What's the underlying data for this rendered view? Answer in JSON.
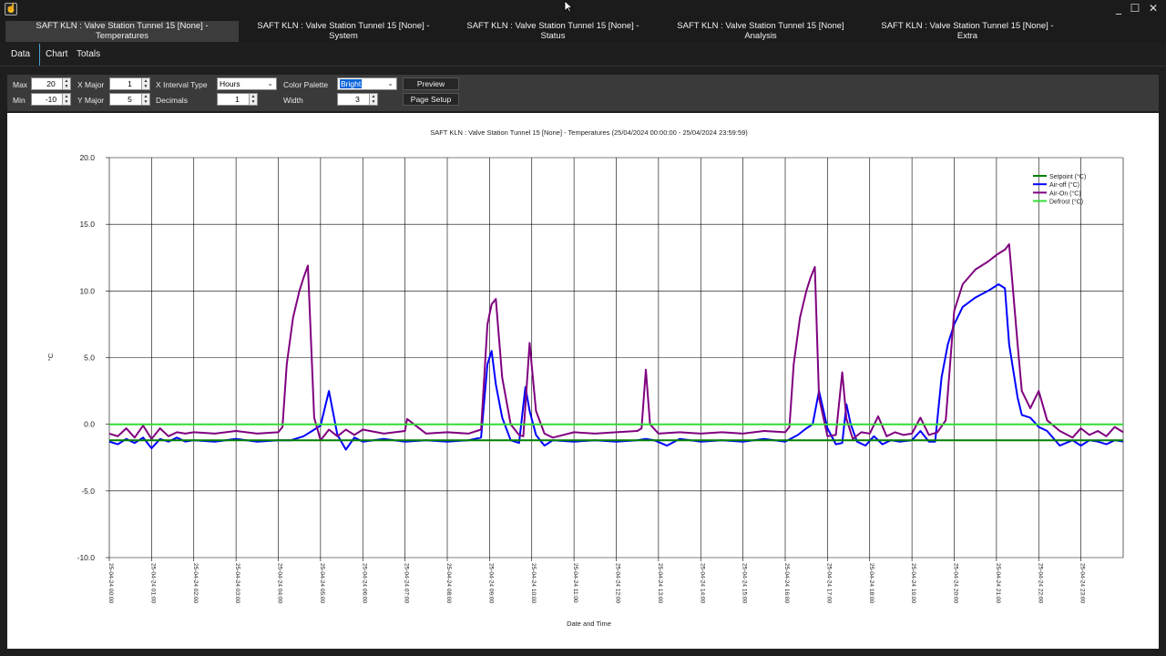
{
  "window": {
    "minimize_glyph": "_",
    "maximize_glyph": "☐",
    "close_glyph": "✕"
  },
  "tabs": [
    {
      "line1": "SAFT KLN : Valve Station Tunnel 15 [None] -",
      "line2": "Temperatures",
      "active": true
    },
    {
      "line1": "SAFT KLN : Valve Station Tunnel 15 [None] -",
      "line2": "System",
      "active": false
    },
    {
      "line1": "SAFT KLN : Valve Station Tunnel 15 [None] -",
      "line2": "Status",
      "active": false
    },
    {
      "line1": "SAFT KLN : Valve Station Tunnel 15 [None]",
      "line2": "Analysis",
      "active": false
    },
    {
      "line1": "SAFT KLN : Valve Station Tunnel 15 [None] -",
      "line2": "Extra",
      "active": false
    }
  ],
  "subtabs": [
    "Data",
    "Chart",
    "Totals"
  ],
  "toolbar": {
    "max_label": "Max",
    "max_value": "20",
    "min_label": "Min",
    "min_value": "-10",
    "x_major_label": "X Major",
    "x_major_value": "1",
    "y_major_label": "Y Major",
    "y_major_value": "5",
    "x_interval_label": "X Interval Type",
    "x_interval_value": "Hours",
    "decimals_label": "Decimals",
    "decimals_value": "1",
    "palette_label": "Color Palette",
    "palette_value": "Bright",
    "width_label": "Width",
    "width_value": "3",
    "preview_label": "Preview",
    "page_setup_label": "Page Setup"
  },
  "chart_data": {
    "type": "line",
    "title": "SAFT KLN : Valve Station Tunnel 15 [None] - Temperatures (25/04/2024 00:00:00 - 25/04/2024 23:59:59)",
    "xlabel": "Date and Time",
    "ylabel": "°C",
    "ylim": [
      -10,
      20
    ],
    "yticks": [
      "20.0",
      "15.0",
      "10.0",
      "5.0",
      "0.0",
      "-5.0",
      "-10.0"
    ],
    "xlim": [
      0,
      24
    ],
    "xticks": [
      "25-04-24 00:00",
      "25-04-24 01:00",
      "25-04-24 02:00",
      "25-04-24 03:00",
      "25-04-24 04:00",
      "25-04-24 05:00",
      "25-04-24 06:00",
      "25-04-24 07:00",
      "25-04-24 08:00",
      "25-04-24 09:00",
      "25-04-24 10:00",
      "25-04-24 11:00",
      "25-04-24 12:00",
      "25-04-24 13:00",
      "25-04-24 14:00",
      "25-04-24 15:00",
      "25-04-24 16:00",
      "25-04-24 17:00",
      "25-04-24 18:00",
      "25-04-24 19:00",
      "25-04-24 20:00",
      "25-04-24 21:00",
      "25-04-24 22:00",
      "25-04-24 23:00"
    ],
    "grid": true,
    "legend_position": "top-right",
    "series": [
      {
        "name": "Setpoint (°C)",
        "color": "#008000",
        "x": [
          0,
          24
        ],
        "y": [
          -1.2,
          -1.2
        ]
      },
      {
        "name": "Air-off (°C)",
        "color": "#0000ff",
        "x": [
          0,
          0.2,
          0.4,
          0.6,
          0.8,
          1.0,
          1.2,
          1.4,
          1.6,
          1.8,
          2.0,
          2.5,
          3.0,
          3.5,
          4.0,
          4.3,
          4.6,
          4.8,
          5.0,
          5.2,
          5.4,
          5.6,
          5.8,
          6.0,
          6.5,
          7.0,
          7.5,
          8.0,
          8.5,
          8.8,
          8.95,
          9.05,
          9.15,
          9.3,
          9.5,
          9.7,
          9.85,
          9.95,
          10.1,
          10.3,
          10.5,
          11.0,
          11.5,
          12.0,
          12.5,
          12.7,
          12.9,
          13.2,
          13.5,
          14.0,
          14.5,
          15.0,
          15.5,
          16.0,
          16.3,
          16.5,
          16.65,
          16.8,
          17.0,
          17.2,
          17.35,
          17.45,
          17.55,
          17.7,
          17.9,
          18.1,
          18.3,
          18.5,
          18.7,
          19.0,
          19.2,
          19.4,
          19.55,
          19.7,
          19.85,
          20.0,
          20.2,
          20.5,
          20.8,
          21.05,
          21.2,
          21.3,
          21.5,
          21.6,
          21.8,
          22.0,
          22.2,
          22.5,
          22.8,
          23.0,
          23.2,
          23.4,
          23.6,
          23.8,
          24.0
        ],
        "y": [
          -1.3,
          -1.5,
          -1.1,
          -1.4,
          -1.0,
          -1.8,
          -1.1,
          -1.3,
          -1.0,
          -1.3,
          -1.2,
          -1.3,
          -1.1,
          -1.3,
          -1.2,
          -1.2,
          -0.9,
          -0.5,
          -0.1,
          2.5,
          -0.8,
          -1.9,
          -1.0,
          -1.3,
          -1.1,
          -1.3,
          -1.2,
          -1.3,
          -1.2,
          -1.0,
          4.5,
          5.5,
          3.0,
          0.5,
          -1.2,
          -1.4,
          2.8,
          1.0,
          -0.8,
          -1.6,
          -1.2,
          -1.3,
          -1.2,
          -1.3,
          -1.2,
          -1.1,
          -1.2,
          -1.6,
          -1.1,
          -1.3,
          -1.2,
          -1.3,
          -1.1,
          -1.3,
          -0.8,
          -0.3,
          0.0,
          2.5,
          -0.3,
          -1.5,
          -1.4,
          1.5,
          0.0,
          -1.3,
          -1.6,
          -0.9,
          -1.5,
          -1.2,
          -1.3,
          -1.2,
          -0.5,
          -1.3,
          -1.3,
          3.5,
          6.0,
          7.5,
          8.8,
          9.5,
          10.0,
          10.5,
          10.2,
          6.0,
          2.0,
          0.7,
          0.5,
          -0.2,
          -0.5,
          -1.6,
          -1.2,
          -1.6,
          -1.2,
          -1.3,
          -1.5,
          -1.2,
          -1.3
        ]
      },
      {
        "name": "Air-On (°C)",
        "color": "#800080",
        "x": [
          0,
          0.2,
          0.4,
          0.6,
          0.8,
          1.0,
          1.2,
          1.4,
          1.6,
          1.8,
          2.0,
          2.5,
          3.0,
          3.5,
          4.0,
          4.1,
          4.2,
          4.35,
          4.5,
          4.6,
          4.7,
          4.85,
          5.0,
          5.2,
          5.4,
          5.6,
          5.8,
          6.0,
          6.5,
          7.0,
          7.05,
          7.5,
          8.0,
          8.5,
          8.8,
          8.95,
          9.05,
          9.15,
          9.3,
          9.5,
          9.7,
          9.8,
          9.95,
          10.1,
          10.3,
          10.5,
          11.0,
          11.5,
          12.0,
          12.5,
          12.6,
          12.7,
          12.8,
          13.0,
          13.5,
          14.0,
          14.5,
          15.0,
          15.5,
          16.0,
          16.1,
          16.2,
          16.35,
          16.5,
          16.6,
          16.7,
          16.8,
          17.0,
          17.2,
          17.35,
          17.45,
          17.6,
          17.8,
          18.0,
          18.2,
          18.4,
          18.6,
          18.8,
          19.0,
          19.2,
          19.4,
          19.6,
          19.8,
          20.0,
          20.2,
          20.5,
          20.8,
          21.0,
          21.1,
          21.2,
          21.3,
          21.5,
          21.6,
          21.8,
          22.0,
          22.2,
          22.5,
          22.8,
          23.0,
          23.2,
          23.4,
          23.6,
          23.8,
          24.0
        ],
        "y": [
          -0.7,
          -0.9,
          -0.3,
          -1.0,
          -0.1,
          -1.1,
          -0.3,
          -0.9,
          -0.6,
          -0.7,
          -0.6,
          -0.7,
          -0.5,
          -0.7,
          -0.6,
          -0.2,
          4.5,
          8.0,
          10.0,
          11.0,
          11.9,
          0.5,
          -1.2,
          -0.4,
          -0.9,
          -0.4,
          -0.8,
          -0.4,
          -0.7,
          -0.5,
          0.4,
          -0.7,
          -0.6,
          -0.7,
          -0.4,
          7.5,
          9.0,
          9.4,
          3.5,
          0.0,
          -0.8,
          -0.9,
          6.1,
          1.0,
          -0.7,
          -1.0,
          -0.6,
          -0.7,
          -0.6,
          -0.5,
          -0.3,
          4.1,
          0.0,
          -0.7,
          -0.6,
          -0.7,
          -0.6,
          -0.7,
          -0.5,
          -0.6,
          -0.2,
          4.5,
          8.0,
          10.0,
          11.0,
          11.8,
          2.0,
          -0.9,
          -0.8,
          3.9,
          0.4,
          -1.1,
          -0.6,
          -0.7,
          0.6,
          -0.9,
          -0.6,
          -0.8,
          -0.7,
          0.5,
          -0.8,
          -0.6,
          0.3,
          8.5,
          10.5,
          11.6,
          12.2,
          12.7,
          12.9,
          13.1,
          13.5,
          6.0,
          2.5,
          1.2,
          2.5,
          0.3,
          -0.5,
          -1.0,
          -0.3,
          -0.8,
          -0.5,
          -0.9,
          -0.2,
          -0.6
        ]
      },
      {
        "name": "Defrost (°C)",
        "color": "#33dd33",
        "x": [
          0,
          24
        ],
        "y": [
          0.0,
          0.0
        ]
      }
    ]
  }
}
